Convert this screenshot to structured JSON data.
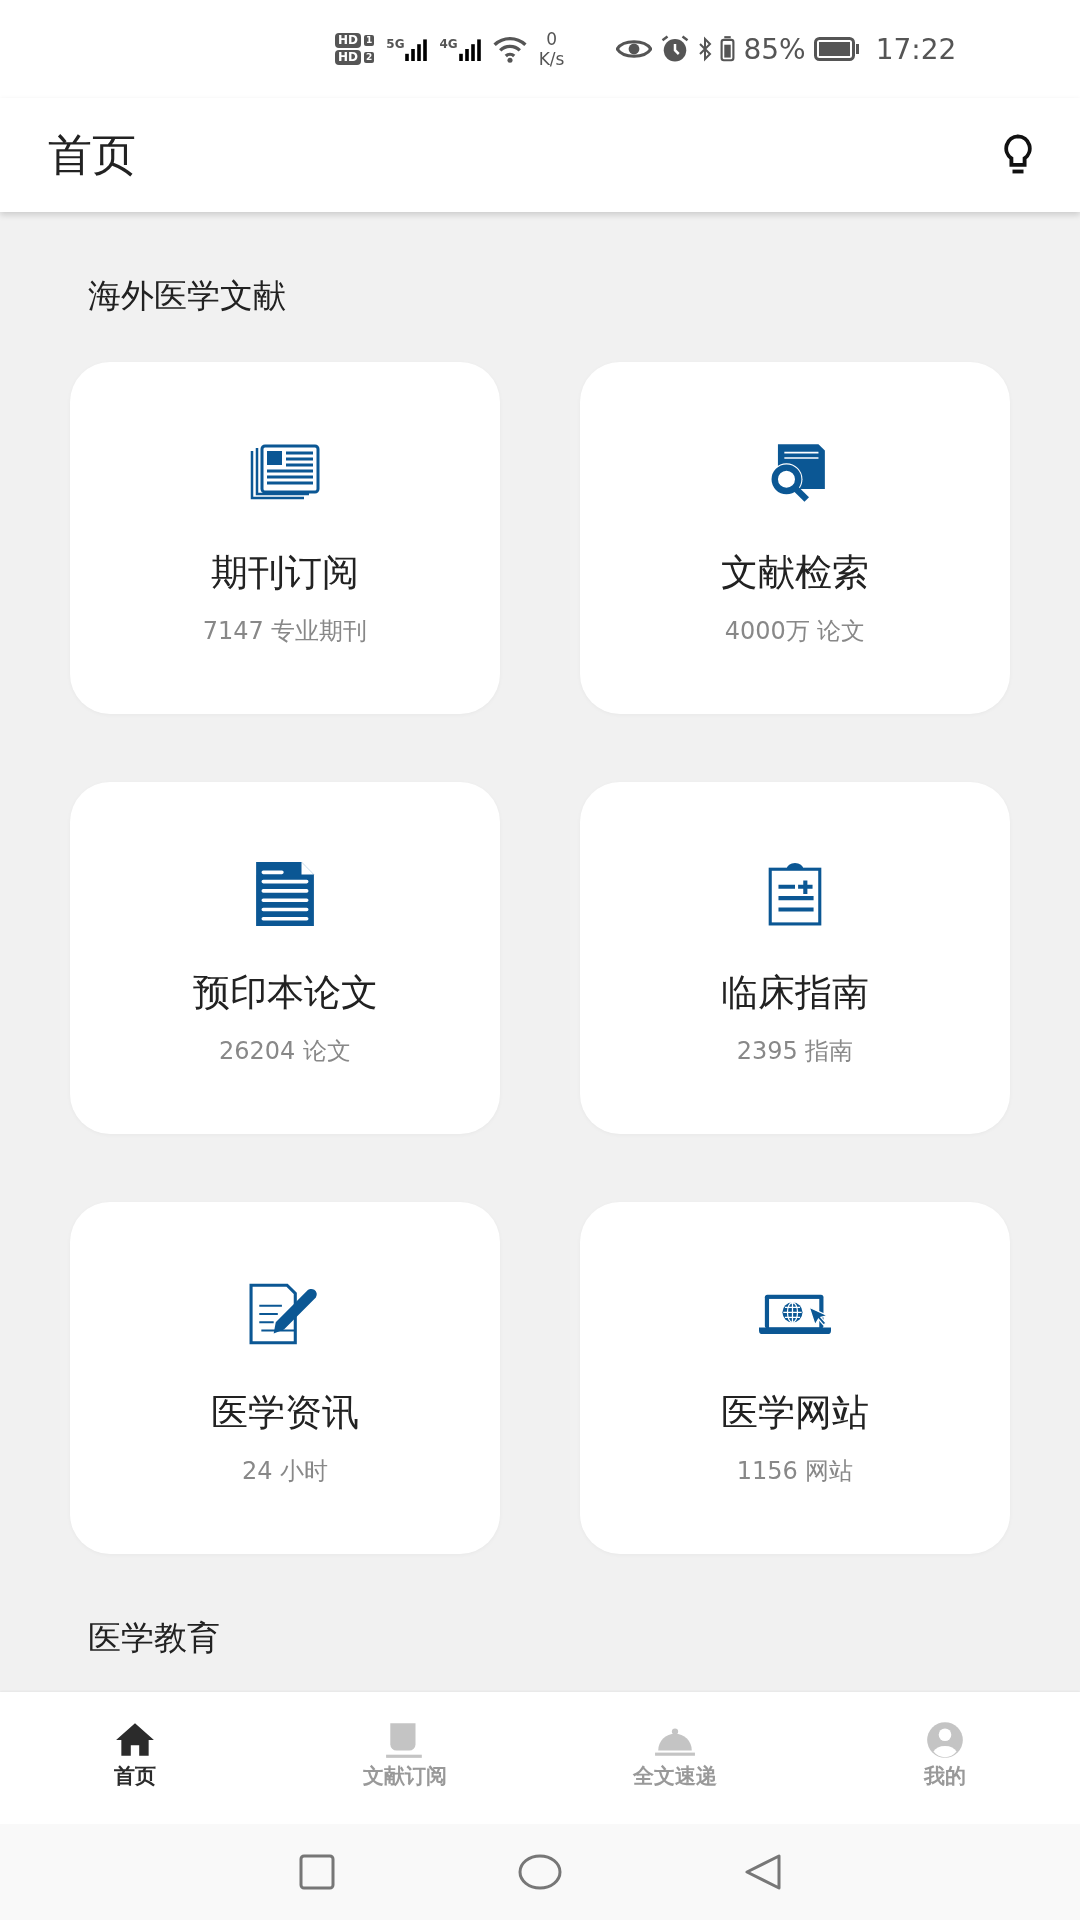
{
  "status_bar": {
    "sims": [
      {
        "badge": "HD",
        "slot": "1"
      },
      {
        "badge": "HD",
        "slot": "2"
      }
    ],
    "networks": [
      "5G",
      "4G"
    ],
    "speed_value": "0",
    "speed_unit": "K/s",
    "battery": "85%",
    "time": "17:22"
  },
  "app_bar": {
    "title": "首页"
  },
  "sections": [
    {
      "title": "海外医学文献",
      "cards": [
        {
          "title": "期刊订阅",
          "subtitle": "7147 专业期刊"
        },
        {
          "title": "文献检索",
          "subtitle": "4000万 论文"
        },
        {
          "title": "预印本论文",
          "subtitle": "26204 论文"
        },
        {
          "title": "临床指南",
          "subtitle": "2395 指南"
        },
        {
          "title": "医学资讯",
          "subtitle": "24 小时"
        },
        {
          "title": "医学网站",
          "subtitle": "1156 网站"
        }
      ]
    },
    {
      "title": "医学教育"
    }
  ],
  "bottom_nav": [
    {
      "label": "首页",
      "selected": true
    },
    {
      "label": "文献订阅",
      "selected": false
    },
    {
      "label": "全文速递",
      "selected": false
    },
    {
      "label": "我的",
      "selected": false
    }
  ]
}
